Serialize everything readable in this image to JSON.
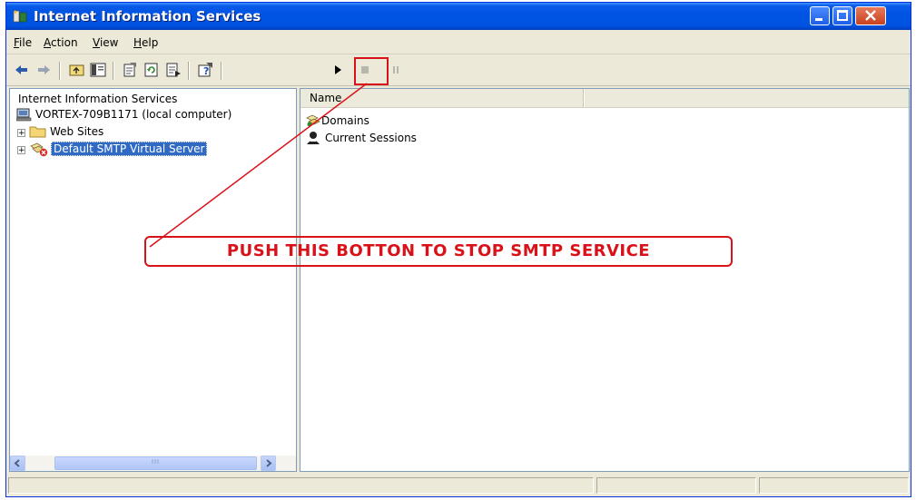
{
  "window": {
    "title": "Internet Information Services"
  },
  "menu": {
    "items": [
      {
        "label": "File",
        "accel": "F"
      },
      {
        "label": "Action",
        "accel": "A"
      },
      {
        "label": "View",
        "accel": "V"
      },
      {
        "label": "Help",
        "accel": "H"
      }
    ]
  },
  "toolbar": {
    "buttons": [
      "back-arrow-icon",
      "forward-arrow-icon",
      "up-folder-icon",
      "show-hide-tree-icon",
      "properties-icon",
      "refresh-icon",
      "export-list-icon",
      "help-icon",
      "start-play-icon",
      "stop-square-icon",
      "pause-icon"
    ]
  },
  "tree": {
    "header": "Internet Information Services",
    "computer": "VORTEX-709B1171 (local computer)",
    "web_sites": "Web Sites",
    "smtp_server": "Default SMTP Virtual Server"
  },
  "list": {
    "column_name": "Name",
    "items": [
      {
        "label": "Domains",
        "icon": "domains-icon"
      },
      {
        "label": "Current Sessions",
        "icon": "sessions-icon"
      }
    ]
  },
  "annotation": {
    "text": "PUSH THIS BOTTON TO STOP SMTP SERVICE",
    "color": "#d9121a"
  },
  "colors": {
    "titlebar": "#0054e3",
    "window_bg": "#ece9d8",
    "selection": "#316ac5"
  }
}
